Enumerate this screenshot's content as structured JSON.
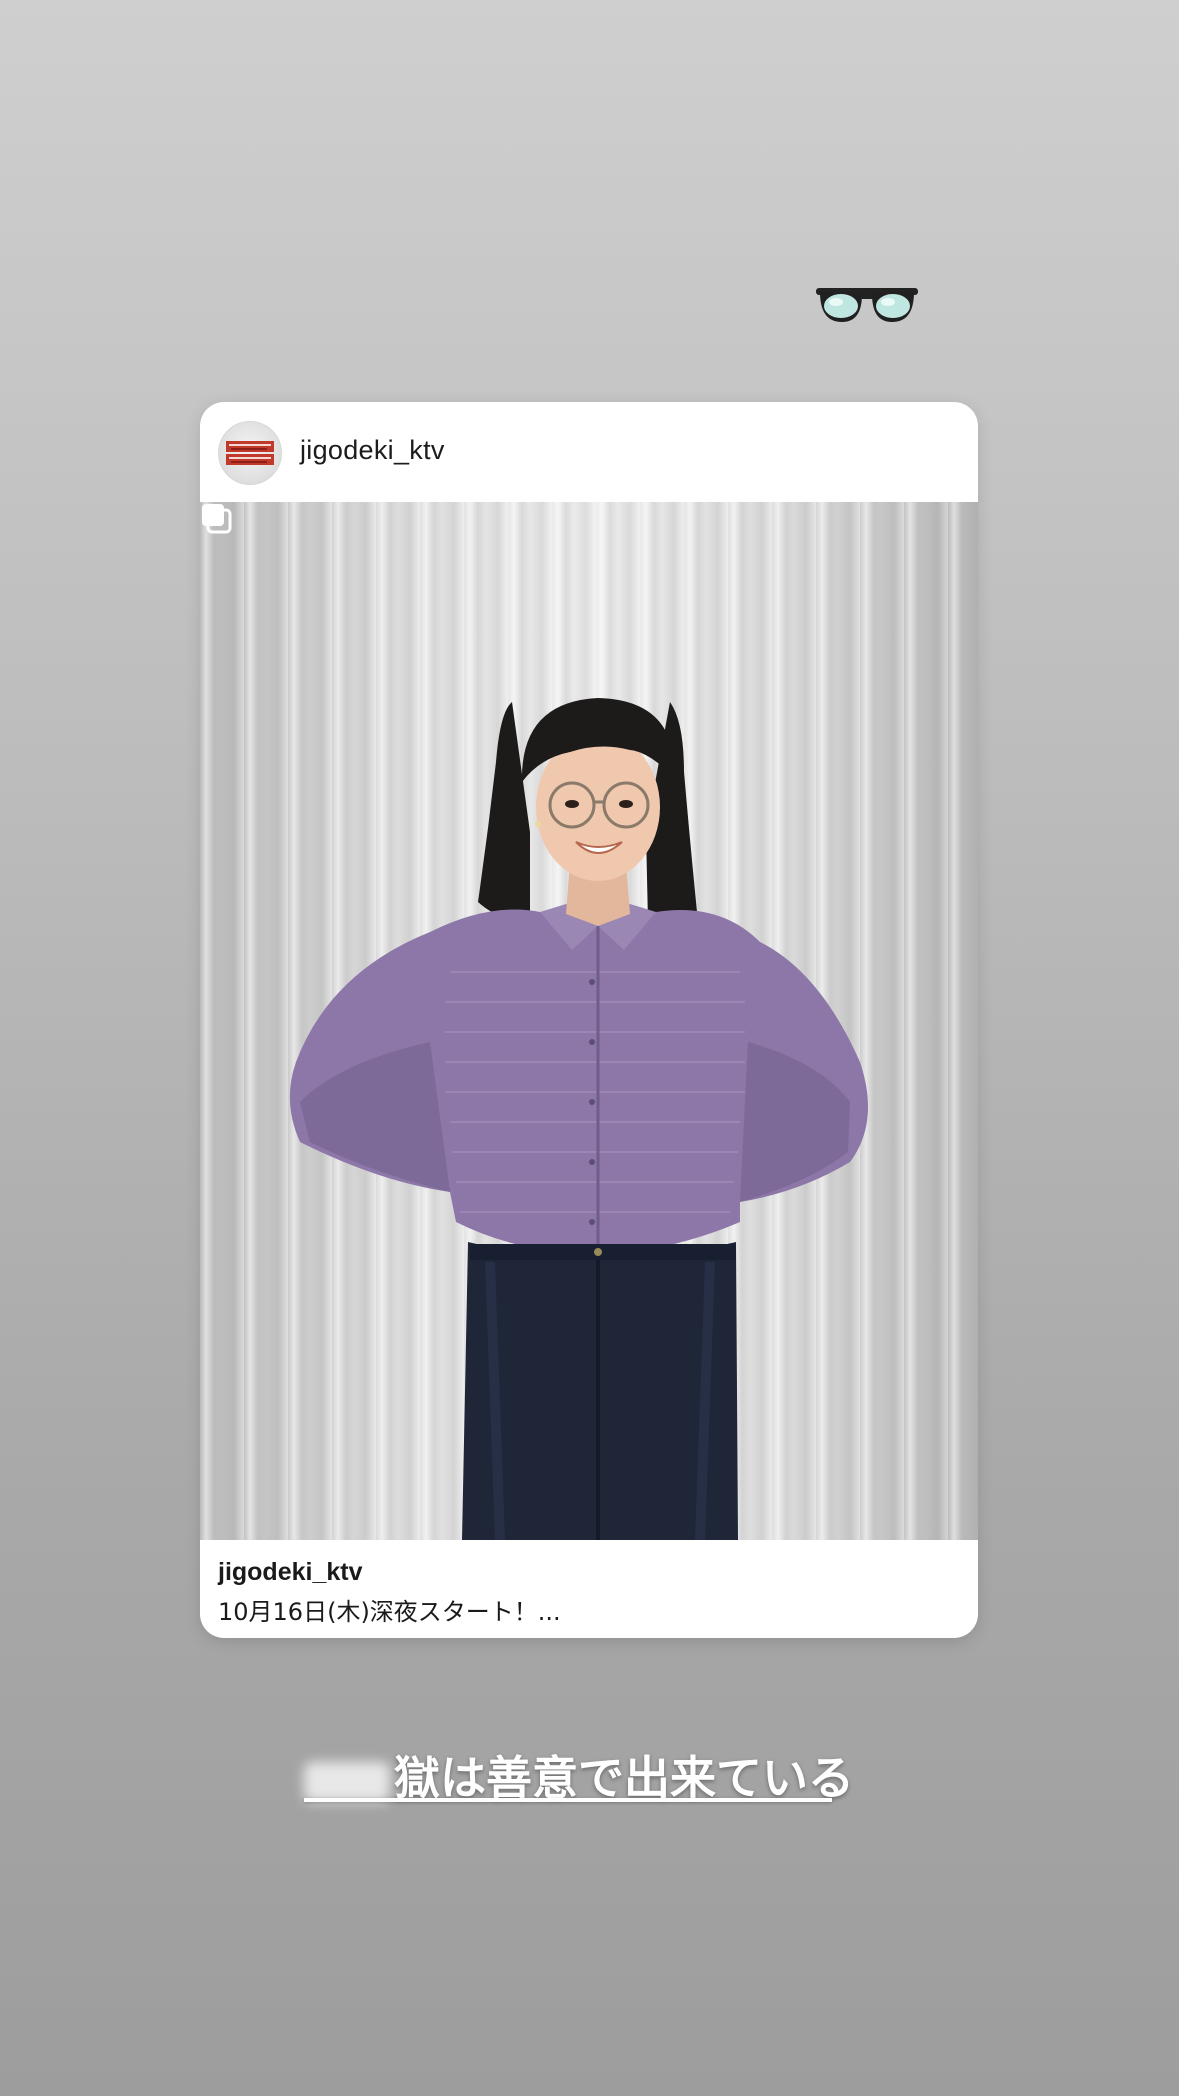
{
  "sticker": {
    "icon": "sunglasses-emoji"
  },
  "post": {
    "header_username": "jigodeki_ktv",
    "avatar_logo_text": "地獄は善意で出来ている",
    "multi_image_icon": "carousel-icon",
    "footer_username": "jigodeki_ktv",
    "caption": "10月16日(木)深夜スタート！..."
  },
  "story_text": {
    "visible_text": "獄は善意で出来ている"
  },
  "colors": {
    "background_top": "#cfcfcf",
    "background_bottom": "#9d9d9d",
    "card": "#ffffff",
    "shirt": "#8c77a8",
    "jeans": "#1f2638"
  }
}
